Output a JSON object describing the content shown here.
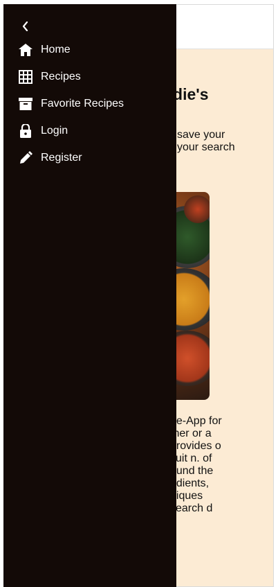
{
  "drawer": {
    "items": [
      {
        "label": "Home",
        "icon": "home-icon"
      },
      {
        "label": "Recipes",
        "icon": "grid-icon"
      },
      {
        "label": "Favorite Recipes",
        "icon": "archive-icon"
      },
      {
        "label": "Login",
        "icon": "lock-icon"
      },
      {
        "label": "Register",
        "icon": "pen-icon"
      }
    ]
  },
  "main": {
    "title": "odie's",
    "intro": "save your your search",
    "body": "pe-App for ther or a provides o suit n. of ound the edients, niques search d"
  },
  "colors": {
    "drawer_bg": "#130a07",
    "content_bg": "#fcebd4"
  }
}
